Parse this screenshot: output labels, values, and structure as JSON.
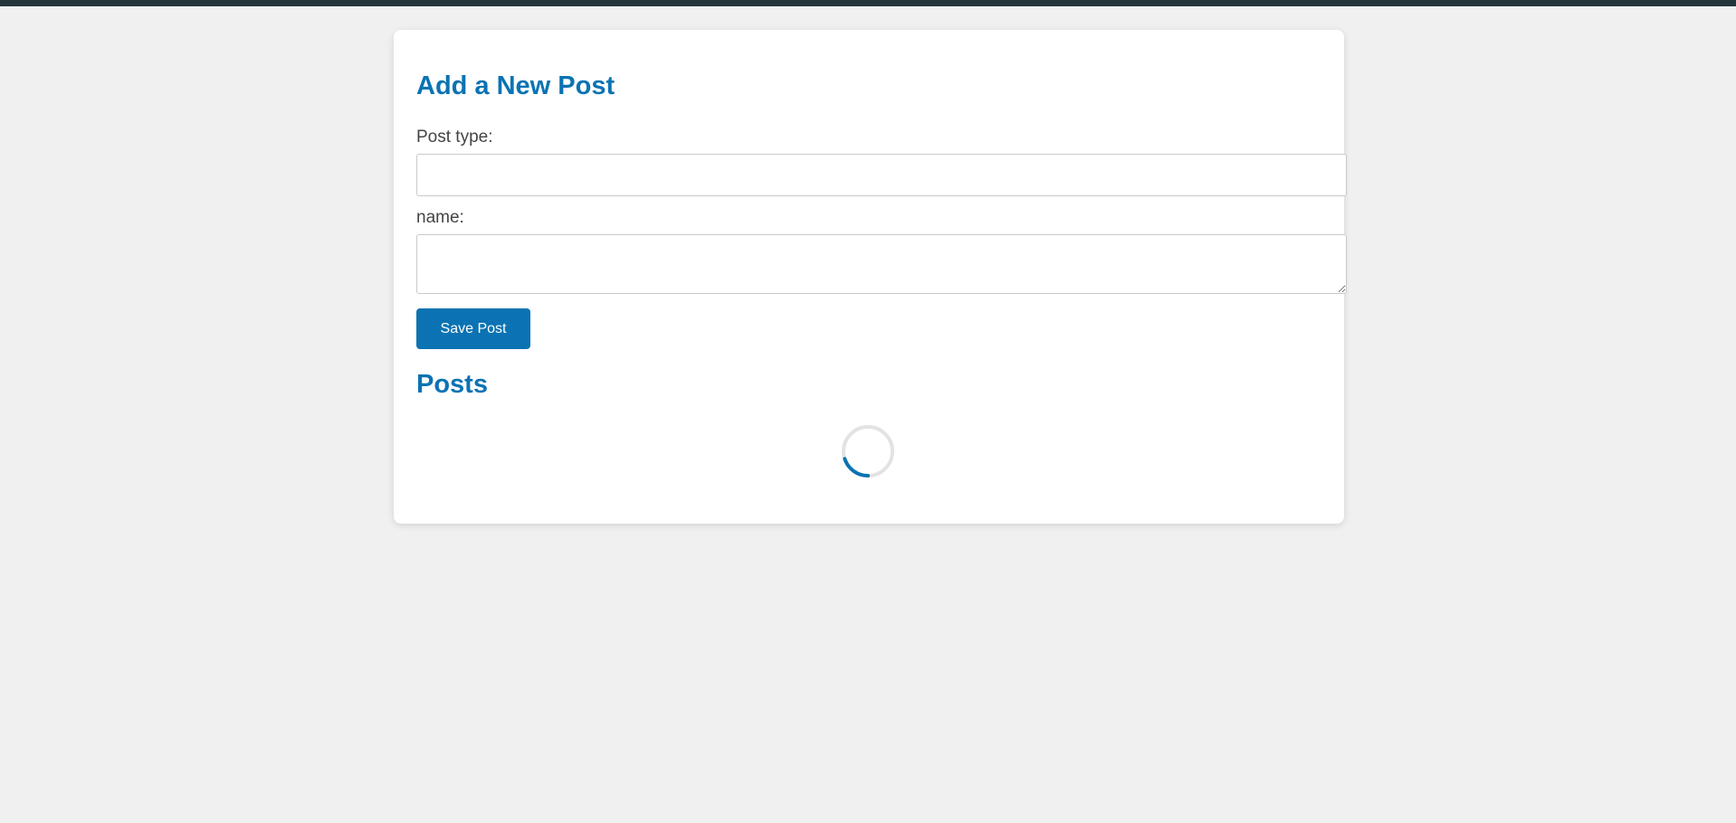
{
  "form": {
    "title": "Add a New Post",
    "post_type_label": "Post type:",
    "post_type_value": "",
    "name_label": "name:",
    "name_value": "",
    "save_label": "Save Post"
  },
  "posts": {
    "title": "Posts",
    "loading_icon": "loading-spinner-icon"
  },
  "colors": {
    "accent": "#0b73b3",
    "top_bar": "#23373b",
    "background": "#f0f0f0"
  }
}
